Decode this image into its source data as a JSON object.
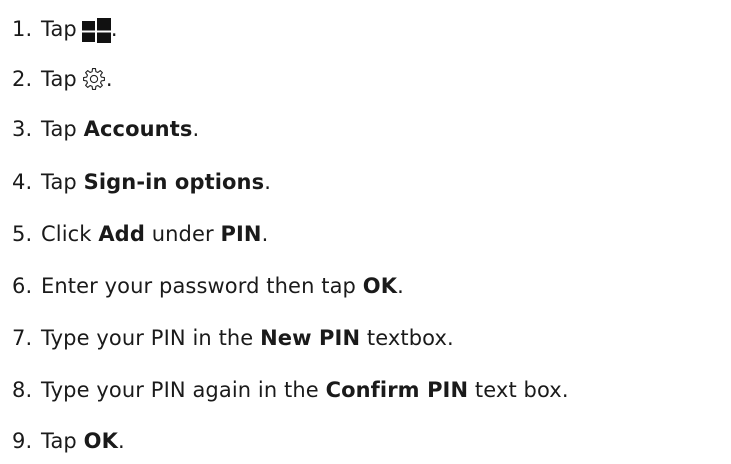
{
  "steps": [
    {
      "num": "1.",
      "prefix": "Tap",
      "icon": "windows-start-icon",
      "suffix": "."
    },
    {
      "num": "2.",
      "prefix": "Tap",
      "icon": "gear-icon",
      "suffix": "."
    },
    {
      "num": "3.",
      "prefix": "Tap ",
      "bold": "Accounts",
      "suffix": "."
    },
    {
      "num": "4.",
      "prefix": "Tap ",
      "bold": "Sign-in options",
      "suffix": "."
    },
    {
      "num": "5.",
      "prefix": "Click ",
      "bold": "Add",
      "middle": " under ",
      "bold2": "PIN",
      "suffix": "."
    },
    {
      "num": "6.",
      "prefix": "Enter your password then tap ",
      "bold": "OK",
      "suffix": "."
    },
    {
      "num": "7.",
      "prefix": "Type your PIN in the ",
      "bold": "New PIN",
      "suffix": " textbox."
    },
    {
      "num": "8.",
      "prefix": "Type your PIN again in the ",
      "bold": "Confirm PIN",
      "suffix": " text box."
    },
    {
      "num": "9.",
      "prefix": "Tap ",
      "bold": "OK",
      "suffix": "."
    }
  ]
}
